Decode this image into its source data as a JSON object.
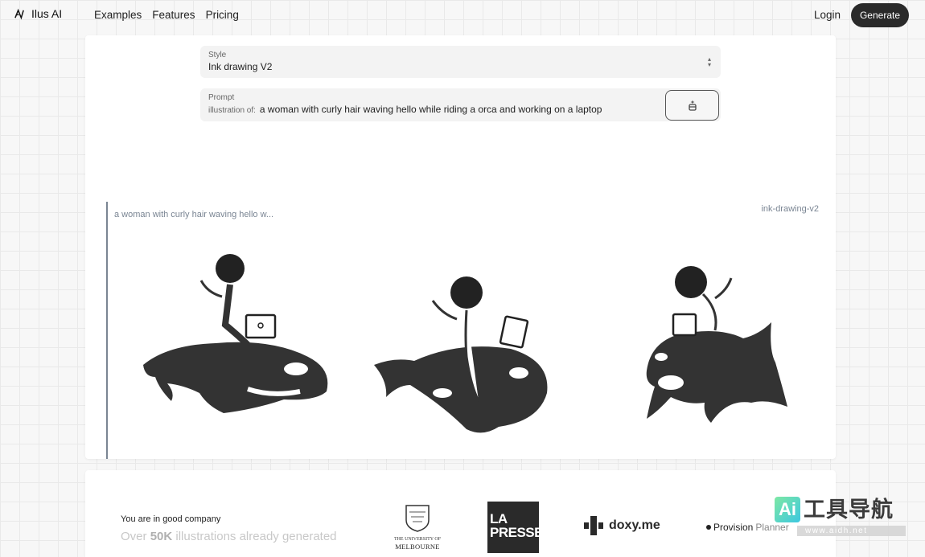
{
  "nav": {
    "brand": "Ilus AI",
    "links": [
      "Examples",
      "Features",
      "Pricing"
    ],
    "login": "Login",
    "generate": "Generate"
  },
  "form": {
    "style_label": "Style",
    "style_value": "Ink drawing V2",
    "prompt_label": "Prompt",
    "prompt_prefix": "illustration of:",
    "prompt_value": "a woman with curly hair waving hello while riding a orca and working on a laptop",
    "magic_icon": "magic-wand-icon"
  },
  "results": {
    "title": "a woman with curly hair waving hello w...",
    "style_tag": "ink-drawing-v2",
    "image_count": 3
  },
  "social_proof": {
    "lead": "You are in good company",
    "stat_prefix": "Over",
    "stat_number": "50K",
    "stat_suffix": "illustrations already generated",
    "logos": {
      "melbourne_line1": "THE UNIVERSITY OF",
      "melbourne_line2": "MELBOURNE",
      "presse_line1": "LA",
      "presse_line2": "PRESSE",
      "doxy": "doxy.me",
      "provision_bold": "Provision",
      "provision_light": "Planner"
    }
  },
  "watermark": {
    "mark": "Ai",
    "cn": "工具导航",
    "url": "www.aidh.net"
  }
}
